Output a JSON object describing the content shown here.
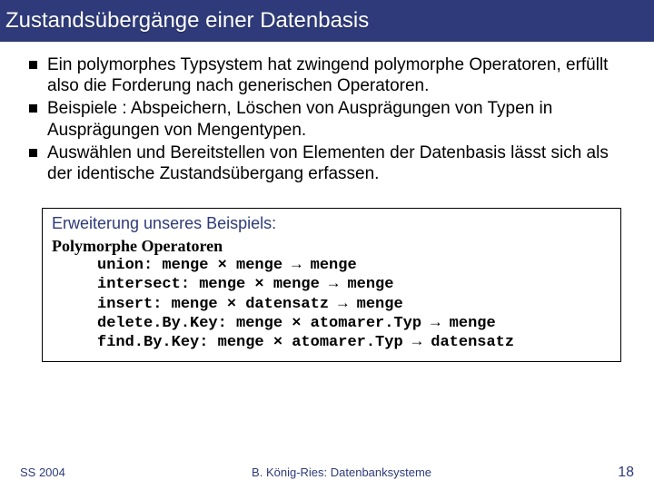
{
  "title": "Zustandsübergänge einer Datenbasis",
  "bullets": [
    "Ein polymorphes Typsystem hat zwingend polymorphe Operatoren, erfüllt also die Forderung nach generischen Operatoren.",
    "Beispiele : Abspeichern, Löschen von Ausprägungen von Typen in Ausprägungen von Mengentypen.",
    "Auswählen und Bereitstellen von Elementen der Datenbasis lässt sich als der identische Zustandsübergang erfassen."
  ],
  "box": {
    "title": "Erweiterung unseres Beispiels:",
    "ops_heading": "Polymorphe Operatoren",
    "times": "×",
    "arrow": "→",
    "ops": [
      {
        "name": "union",
        "lhs": [
          "menge",
          "menge"
        ],
        "rhs": "menge"
      },
      {
        "name": "intersect",
        "lhs": [
          "menge",
          "menge"
        ],
        "rhs": "menge"
      },
      {
        "name": "insert",
        "lhs": [
          "menge",
          "datensatz"
        ],
        "rhs": "menge"
      },
      {
        "name": "delete.By.Key",
        "lhs": [
          "menge",
          "atomarer.Typ"
        ],
        "rhs": "menge"
      },
      {
        "name": "find.By.Key",
        "lhs": [
          "menge",
          "atomarer.Typ"
        ],
        "rhs": "datensatz"
      }
    ]
  },
  "footer": {
    "left": "SS 2004",
    "center": "B. König-Ries: Datenbanksysteme",
    "page": "18"
  }
}
